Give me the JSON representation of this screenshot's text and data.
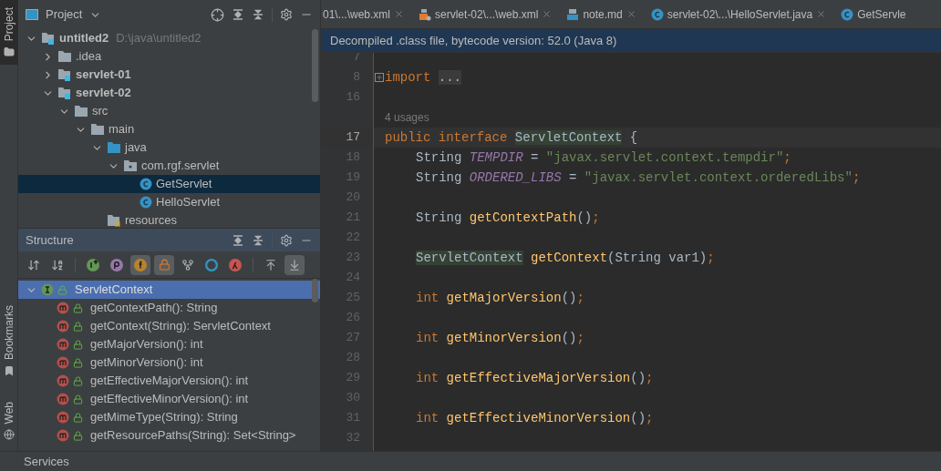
{
  "tool_stripe": [
    {
      "label": "Project",
      "selected": true,
      "kind": "folder"
    },
    {
      "label": "Bookmarks",
      "selected": false,
      "kind": "bookmark"
    },
    {
      "label": "Web",
      "selected": false,
      "kind": "globe"
    }
  ],
  "project_panel": {
    "title": "Project",
    "tree": [
      {
        "label": "untitled2",
        "hint": "D:\\java\\untitled2",
        "kind": "module",
        "expanded": true,
        "selected": false,
        "children": [
          {
            "label": ".idea",
            "kind": "folder",
            "expanded": false,
            "selected": false
          },
          {
            "label": "servlet-01",
            "kind": "module",
            "expanded": false,
            "selected": false
          },
          {
            "label": "servlet-02",
            "kind": "module",
            "expanded": true,
            "selected": false,
            "children": [
              {
                "label": "src",
                "kind": "folder",
                "expanded": true,
                "selected": false,
                "children": [
                  {
                    "label": "main",
                    "kind": "folder",
                    "expanded": true,
                    "selected": false,
                    "children": [
                      {
                        "label": "java",
                        "kind": "source",
                        "expanded": true,
                        "selected": false,
                        "children": [
                          {
                            "label": "com.rgf.servlet",
                            "kind": "package",
                            "expanded": true,
                            "selected": false,
                            "children": [
                              {
                                "label": "GetServlet",
                                "kind": "class",
                                "selected": true
                              },
                              {
                                "label": "HelloServlet",
                                "kind": "class",
                                "selected": false
                              }
                            ]
                          }
                        ]
                      },
                      {
                        "label": "resources",
                        "kind": "resources",
                        "selected": false
                      }
                    ]
                  }
                ]
              }
            ]
          }
        ]
      }
    ]
  },
  "structure_panel": {
    "title": "Structure",
    "toolbar": [
      {
        "kind": "sort-visibility",
        "on": false
      },
      {
        "kind": "sort-alpha",
        "on": false
      },
      {
        "kind": "inherited",
        "on": false
      },
      {
        "kind": "properties",
        "on": false
      },
      {
        "kind": "fields",
        "on": true
      },
      {
        "kind": "non-public",
        "on": true
      },
      {
        "kind": "lambdas-tree",
        "on": false
      },
      {
        "kind": "anonymous",
        "on": false
      },
      {
        "kind": "lambdas",
        "on": false
      },
      {
        "kind": "scroll-from",
        "on": false
      },
      {
        "kind": "scroll-to",
        "on": true
      }
    ],
    "root": {
      "label": "ServletContext",
      "expanded": true,
      "selected": true,
      "members": [
        {
          "label": "getContextPath(): String",
          "selected": false
        },
        {
          "label": "getContext(String): ServletContext",
          "selected": false
        },
        {
          "label": "getMajorVersion(): int",
          "selected": false
        },
        {
          "label": "getMinorVersion(): int",
          "selected": false
        },
        {
          "label": "getEffectiveMajorVersion(): int",
          "selected": false
        },
        {
          "label": "getEffectiveMinorVersion(): int",
          "selected": false
        },
        {
          "label": "getMimeType(String): String",
          "selected": false
        },
        {
          "label": "getResourcePaths(String): Set<String>",
          "selected": false
        }
      ]
    }
  },
  "editor_tabs": [
    {
      "label": "01\\...\\web.xml",
      "kind": "none",
      "closable": true
    },
    {
      "label": "servlet-02\\...\\web.xml",
      "kind": "xml",
      "closable": true
    },
    {
      "label": "note.md",
      "kind": "md",
      "closable": true
    },
    {
      "label": "servlet-02\\...\\HelloServlet.java",
      "kind": "class",
      "closable": true
    },
    {
      "label": "GetServle",
      "kind": "class",
      "closable": false
    }
  ],
  "banner": "Decompiled .class file, bytecode version: 52.0 (Java 8)",
  "code": [
    {
      "number": "7",
      "current": false
    },
    {
      "number": "8",
      "current": false,
      "fold": true,
      "indented": false,
      "tokens": [
        {
          "text": "import ",
          "kind": "keyword"
        },
        {
          "text": "...",
          "kind": "folded"
        }
      ]
    },
    {
      "number": "16",
      "current": false
    },
    {
      "kind": "hint",
      "text": "4 usages"
    },
    {
      "number": "17",
      "current": true,
      "indented": false,
      "tokens": [
        {
          "text": "public interface ",
          "kind": "keyword"
        },
        {
          "text": "ServletContext",
          "kind": "match"
        },
        {
          "text": " {",
          "kind": "plain"
        }
      ]
    },
    {
      "number": "18",
      "current": false,
      "indented": true,
      "tokens": [
        {
          "text": "String ",
          "kind": "plain"
        },
        {
          "text": "TEMPDIR",
          "kind": "field"
        },
        {
          "text": " = ",
          "kind": "plain"
        },
        {
          "text": "\"javax.servlet.context.tempdir\"",
          "kind": "string"
        },
        {
          "text": ";",
          "kind": "keyword"
        }
      ]
    },
    {
      "number": "19",
      "current": false,
      "indented": true,
      "tokens": [
        {
          "text": "String ",
          "kind": "plain"
        },
        {
          "text": "ORDERED_LIBS",
          "kind": "field"
        },
        {
          "text": " = ",
          "kind": "plain"
        },
        {
          "text": "\"javax.servlet.context.orderedLibs\"",
          "kind": "string"
        },
        {
          "text": ";",
          "kind": "keyword"
        }
      ]
    },
    {
      "number": "20",
      "current": false
    },
    {
      "number": "21",
      "current": false,
      "indented": true,
      "tokens": [
        {
          "text": "String ",
          "kind": "plain"
        },
        {
          "text": "getContextPath",
          "kind": "method"
        },
        {
          "text": "()",
          "kind": "plain"
        },
        {
          "text": ";",
          "kind": "keyword"
        }
      ]
    },
    {
      "number": "22",
      "current": false
    },
    {
      "number": "23",
      "current": false,
      "indented": true,
      "tokens": [
        {
          "text": "ServletContext",
          "kind": "match"
        },
        {
          "text": " getContext",
          "kind": "method"
        },
        {
          "text": "(String var1)",
          "kind": "plain"
        },
        {
          "text": ";",
          "kind": "keyword"
        }
      ]
    },
    {
      "number": "24",
      "current": false
    },
    {
      "number": "25",
      "current": false,
      "indented": true,
      "tokens": [
        {
          "text": "int ",
          "kind": "keyword"
        },
        {
          "text": "getMajorVersion",
          "kind": "method"
        },
        {
          "text": "()",
          "kind": "plain"
        },
        {
          "text": ";",
          "kind": "keyword"
        }
      ]
    },
    {
      "number": "26",
      "current": false
    },
    {
      "number": "27",
      "current": false,
      "indented": true,
      "tokens": [
        {
          "text": "int ",
          "kind": "keyword"
        },
        {
          "text": "getMinorVersion",
          "kind": "method"
        },
        {
          "text": "()",
          "kind": "plain"
        },
        {
          "text": ";",
          "kind": "keyword"
        }
      ]
    },
    {
      "number": "28",
      "current": false
    },
    {
      "number": "29",
      "current": false,
      "indented": true,
      "tokens": [
        {
          "text": "int ",
          "kind": "keyword"
        },
        {
          "text": "getEffectiveMajorVersion",
          "kind": "method"
        },
        {
          "text": "()",
          "kind": "plain"
        },
        {
          "text": ";",
          "kind": "keyword"
        }
      ]
    },
    {
      "number": "30",
      "current": false
    },
    {
      "number": "31",
      "current": false,
      "indented": true,
      "tokens": [
        {
          "text": "int ",
          "kind": "keyword"
        },
        {
          "text": "getEffectiveMinorVersion",
          "kind": "method"
        },
        {
          "text": "()",
          "kind": "plain"
        },
        {
          "text": ";",
          "kind": "keyword"
        }
      ]
    },
    {
      "number": "32",
      "current": false
    }
  ],
  "status_bar": {
    "label": "Services"
  }
}
